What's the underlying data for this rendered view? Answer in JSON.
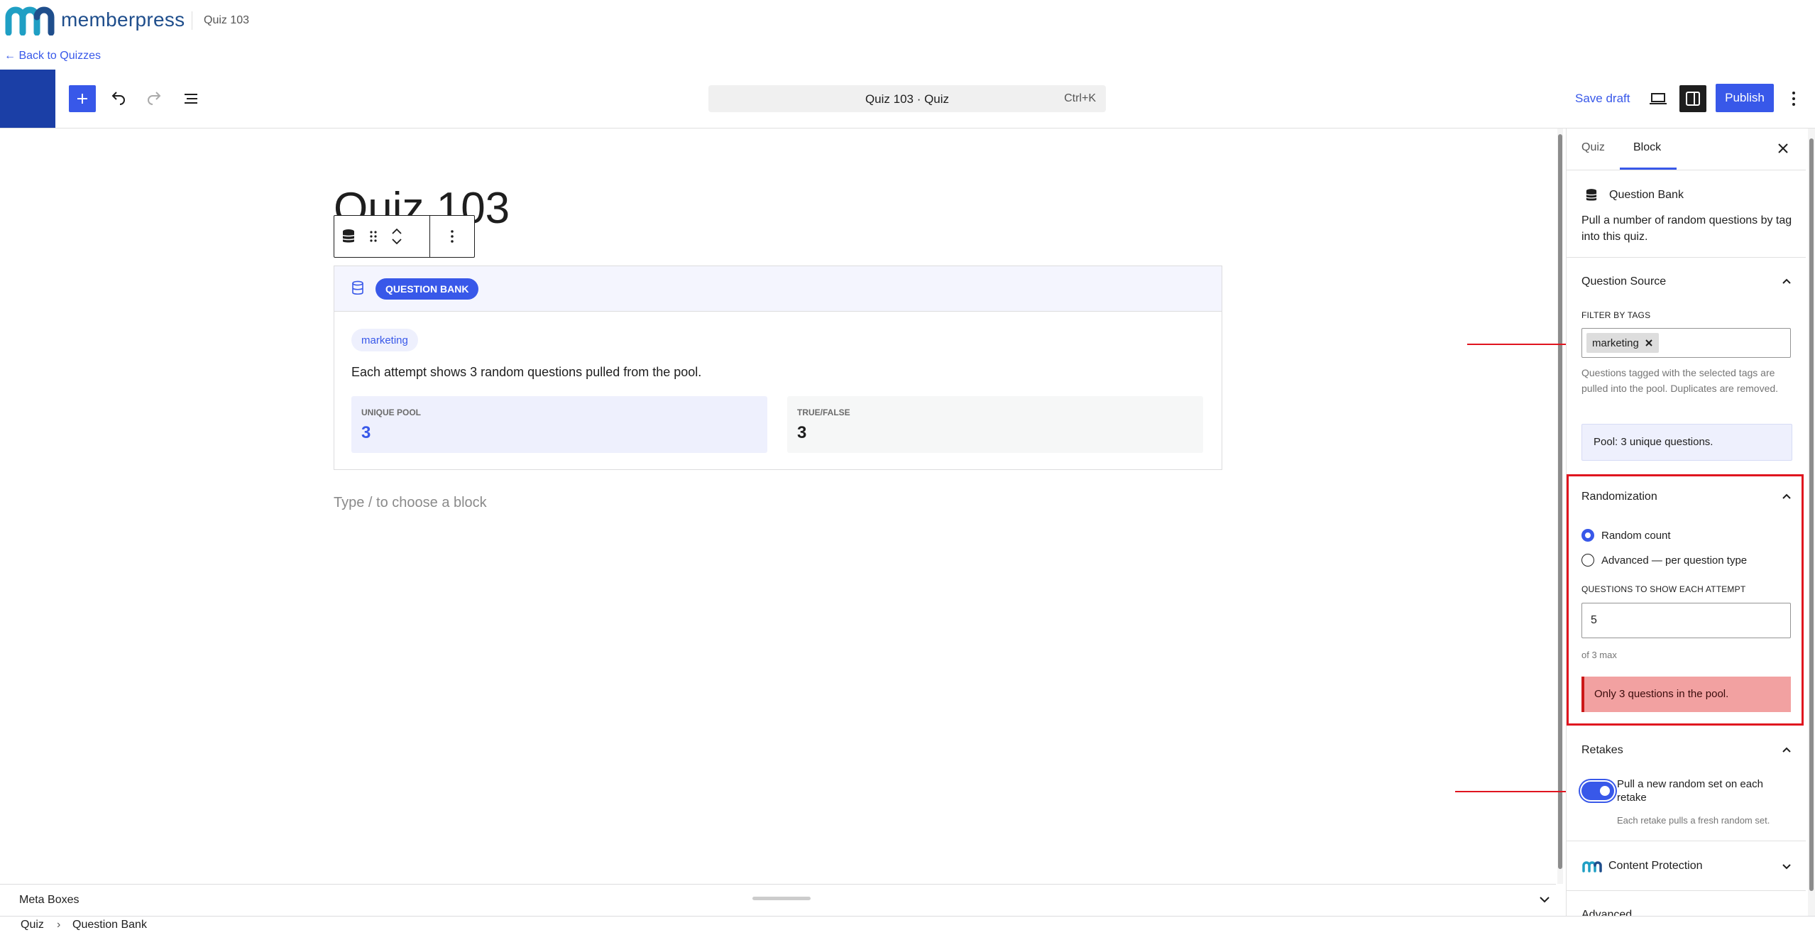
{
  "brand": {
    "name": "memberpress",
    "page_title": "Quiz 103",
    "back_link": "← Back to Quizzes",
    "accent": "#3858e9"
  },
  "header": {
    "command_title": "Quiz 103 · Quiz",
    "command_shortcut": "Ctrl+K",
    "save_draft": "Save draft",
    "publish": "Publish"
  },
  "editor": {
    "post_title": "Quiz 103",
    "block": {
      "badge": "QUESTION BANK",
      "tag": "marketing",
      "description": "Each attempt shows 3 random questions pulled from the pool.",
      "stats": [
        {
          "label": "UNIQUE POOL",
          "value": "3"
        },
        {
          "label": "TRUE/FALSE",
          "value": "3"
        }
      ]
    },
    "placeholder": "Type / to choose a block"
  },
  "meta_boxes": {
    "label": "Meta Boxes"
  },
  "breadcrumbs": {
    "items": [
      "Quiz",
      "Question Bank"
    ]
  },
  "sidebar": {
    "tabs": [
      "Quiz",
      "Block"
    ],
    "block_card": {
      "title": "Question Bank",
      "description": "Pull a number of random questions by tag into this quiz."
    },
    "question_source": {
      "title": "Question Source",
      "filter_label": "FILTER BY TAGS",
      "token": "marketing",
      "help": "Questions tagged with the selected tags are pulled into the pool. Duplicates are removed.",
      "pool_note": "Pool: 3 unique questions."
    },
    "randomization": {
      "title": "Randomization",
      "options": [
        "Random count",
        "Advanced — per question type"
      ],
      "selected": "Random count",
      "count_label": "QUESTIONS TO SHOW EACH ATTEMPT",
      "count_value": "5",
      "count_help": "of 3 max",
      "error": "Only 3 questions in the pool."
    },
    "retakes": {
      "title": "Retakes",
      "toggle_label": "Pull a new random set on each retake",
      "toggle_on": true,
      "help": "Each retake pulls a fresh random set."
    },
    "content_protection": {
      "title": "Content Protection"
    },
    "advanced": {
      "title": "Advanced"
    }
  }
}
